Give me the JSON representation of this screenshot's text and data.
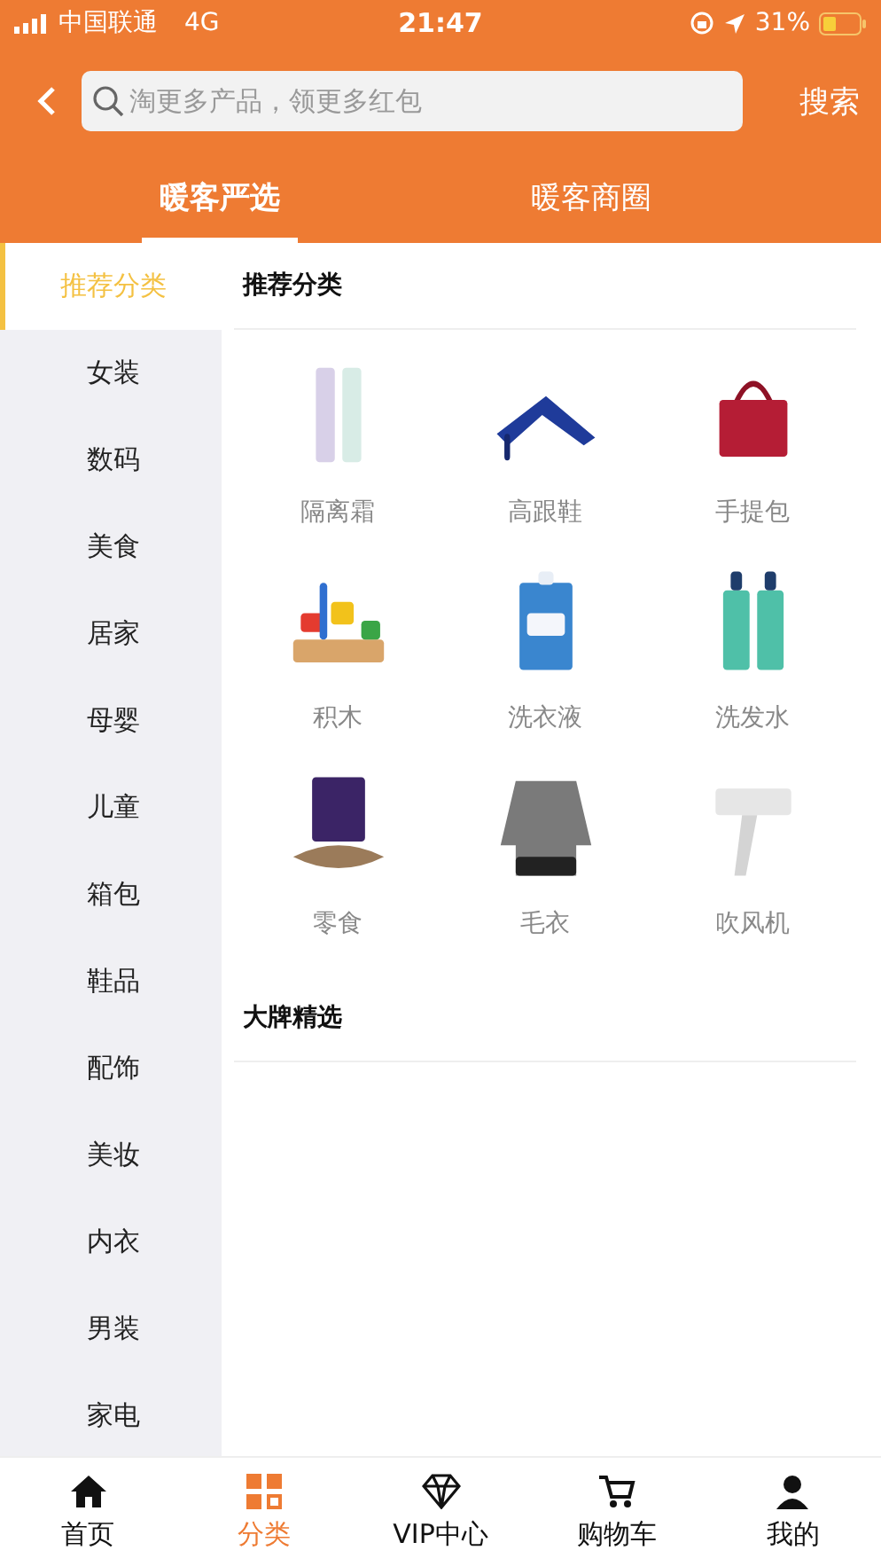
{
  "status_bar": {
    "carrier": "中国联通",
    "network": "4G",
    "time": "21:47",
    "battery": "31%"
  },
  "header": {
    "search": {
      "placeholder": "淘更多产品，领更多红包"
    },
    "search_button": "搜索"
  },
  "tabs": [
    {
      "label": "暖客严选",
      "selected": true
    },
    {
      "label": "暖客商圈",
      "selected": false
    }
  ],
  "sidebar": {
    "items": [
      {
        "label": "推荐分类",
        "selected": true
      },
      {
        "label": "女装",
        "selected": false
      },
      {
        "label": "数码",
        "selected": false
      },
      {
        "label": "美食",
        "selected": false
      },
      {
        "label": "居家",
        "selected": false
      },
      {
        "label": "母婴",
        "selected": false
      },
      {
        "label": "儿童",
        "selected": false
      },
      {
        "label": "箱包",
        "selected": false
      },
      {
        "label": "鞋品",
        "selected": false
      },
      {
        "label": "配饰",
        "selected": false
      },
      {
        "label": "美妆",
        "selected": false
      },
      {
        "label": "内衣",
        "selected": false
      },
      {
        "label": "男装",
        "selected": false
      },
      {
        "label": "家电",
        "selected": false
      }
    ]
  },
  "sections": [
    {
      "title": "推荐分类",
      "products": [
        {
          "label": "隔离霜"
        },
        {
          "label": "高跟鞋"
        },
        {
          "label": "手提包"
        },
        {
          "label": "积木"
        },
        {
          "label": "洗衣液"
        },
        {
          "label": "洗发水"
        },
        {
          "label": "零食"
        },
        {
          "label": "毛衣"
        },
        {
          "label": "吹风机"
        }
      ]
    },
    {
      "title": "大牌精选"
    }
  ],
  "bottom_nav": [
    {
      "label": "首页",
      "kind": "home",
      "selected": false
    },
    {
      "label": "分类",
      "kind": "grid",
      "selected": true
    },
    {
      "label": "VIP中心",
      "kind": "diamond",
      "selected": false
    },
    {
      "label": "购物车",
      "kind": "cart",
      "selected": false
    },
    {
      "label": "我的",
      "kind": "person",
      "selected": false
    }
  ]
}
